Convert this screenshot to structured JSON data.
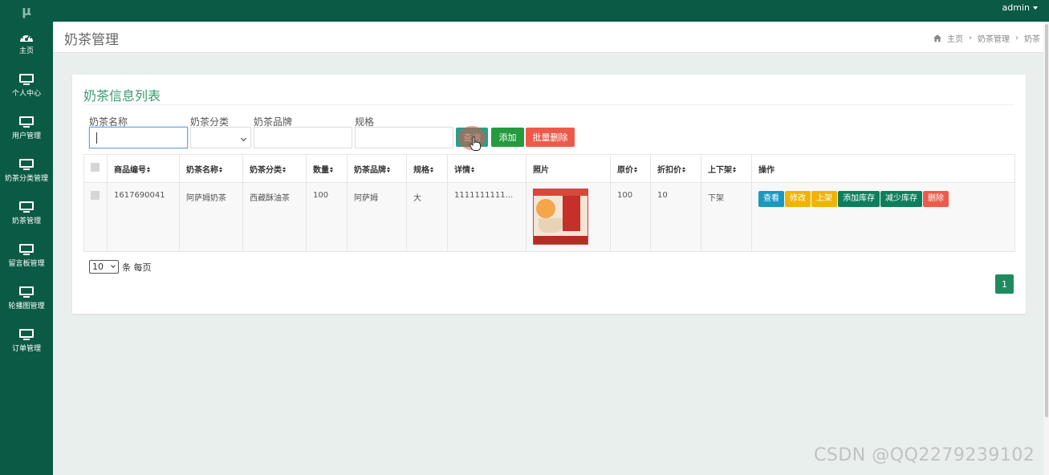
{
  "app": {
    "logo": "μ",
    "user": "admin"
  },
  "sidebar": {
    "items": [
      {
        "label": "主页",
        "icon": "dashboard-icon"
      },
      {
        "label": "个人中心",
        "icon": "monitor-icon"
      },
      {
        "label": "用户管理",
        "icon": "monitor-icon"
      },
      {
        "label": "奶茶分类管理",
        "icon": "monitor-icon"
      },
      {
        "label": "奶茶管理",
        "icon": "monitor-icon"
      },
      {
        "label": "留言板管理",
        "icon": "monitor-icon"
      },
      {
        "label": "轮播图管理",
        "icon": "monitor-icon"
      },
      {
        "label": "订单管理",
        "icon": "monitor-icon"
      }
    ]
  },
  "header": {
    "title": "奶茶管理",
    "breadcrumb": [
      "主页",
      "奶茶管理",
      "奶茶"
    ]
  },
  "card": {
    "title": "奶茶信息列表",
    "filters": {
      "name_label": "奶茶名称",
      "category_label": "奶茶分类",
      "brand_label": "奶茶品牌",
      "spec_label": "规格",
      "name_value": "",
      "category_value": "",
      "brand_value": "",
      "spec_value": ""
    },
    "buttons": {
      "query": "查询",
      "add": "添加",
      "batch_delete": "批量删除"
    },
    "table": {
      "headers": [
        "商品编号",
        "奶茶名称",
        "奶茶分类",
        "数量",
        "奶茶品牌",
        "规格",
        "详情",
        "照片",
        "原价",
        "折扣价",
        "上下架",
        "操作"
      ],
      "rows": [
        {
          "id": "1617690041",
          "name": "阿萨姆奶茶",
          "category": "西藏酥油茶",
          "quantity": "100",
          "brand": "阿萨姆",
          "spec": "大",
          "detail": "1111111111...",
          "original_price": "100",
          "discount_price": "10",
          "status": "下架"
        }
      ],
      "actions": {
        "view": "查看",
        "edit": "修改",
        "shelf": "上架",
        "add_stock": "添加库存",
        "reduce_stock": "减少库存",
        "delete": "删除"
      }
    },
    "pagination": {
      "page_size": "10",
      "page_size_suffix": "条 每页",
      "current_page": "1"
    }
  },
  "watermark": "CSDN @QQ2279239102",
  "colors": {
    "sidebar": "#0b5a46",
    "accent": "#3a9a6e",
    "danger": "#ee5a4a",
    "warning": "#f0b400",
    "info": "#1a98c0"
  }
}
